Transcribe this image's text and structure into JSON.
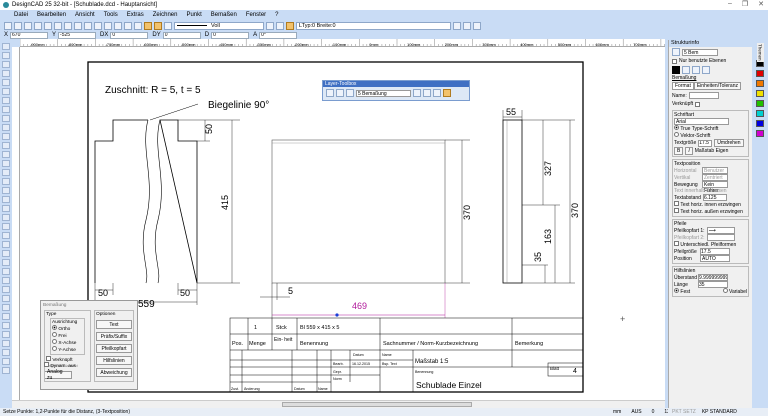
{
  "app": {
    "title": "DesignCAD 25 32-bit - [Schublade.dcd - Hauptansicht]",
    "window_controls": [
      "–",
      "❐",
      "✕"
    ]
  },
  "menu": [
    "Datei",
    "Bearbeiten",
    "Ansicht",
    "Tools",
    "Extras",
    "Zeichnen",
    "Punkt",
    "Bemaßen",
    "Fenster",
    "?"
  ],
  "toolbar": {
    "line_style": "Voll",
    "line_type": "LTyp:0  Breite:0"
  },
  "coords": {
    "x_label": "X",
    "x": "670",
    "y_label": "Y",
    "y": "-525",
    "dx_label": "DX",
    "dx": "0",
    "dy_label": "DY",
    "dy": "0",
    "d_label": "D",
    "d": "0",
    "a_label": "A",
    "a": "0°"
  },
  "ruler": {
    "labels": [
      "-900mm",
      "-800mm",
      "-700mm",
      "-600mm",
      "-500mm",
      "-400mm",
      "-300mm",
      "-200mm",
      "-100mm",
      "0mm",
      "100mm",
      "200mm",
      "300mm",
      "400mm",
      "500mm",
      "600mm",
      "700mm"
    ]
  },
  "drawing": {
    "note": "Zuschnitt: R = 5,  t = 5",
    "bend_label": "Biegelinie 90°",
    "dims": {
      "d50a": "50",
      "d415": "415",
      "d50b": "50",
      "d50c": "50",
      "d559": "559",
      "d370a": "370",
      "d5": "5",
      "d469": "469",
      "d55": "55",
      "d327": "327",
      "d163": "163",
      "d35": "35",
      "d370b": "370"
    },
    "dim_color": "#b0199a",
    "point_color": "#1a3fd6"
  },
  "title_block": {
    "pos_value": "1",
    "unit_value": "Stck",
    "desc_value": "Bl  559 x 415 x 5",
    "headers": [
      "Pos.",
      "Menge",
      "Ein-\nheit",
      "Benennung",
      "Sachnummer / Norm-Kurzbezeichnung",
      "Bemerkung"
    ],
    "datum": "Datum",
    "name": "Name",
    "bearb": "Bearb.",
    "date": "16.12.2015",
    "author": "Bsp. Text",
    "gepr": "Gepr.",
    "norm": "Norm",
    "zust": "Zust.",
    "aenderung": "Änderung",
    "datum2": "Datum",
    "name2": "Name",
    "scale_label": "Maßstab",
    "scale": "1:5",
    "benennung_label": "Benennung",
    "drawing_name": "Schublade Einzel",
    "blatt_label": "Blatt",
    "blatt": "4"
  },
  "layer_toolbox": {
    "title": "Layer-Toolbox",
    "layer": "5  Bemaßung"
  },
  "dimension_dialog": {
    "title": "Bemaßung",
    "type_group": "Type",
    "align_group": "Ausrichtung",
    "align_options": [
      "Ortho",
      "Frei",
      "X-Achse",
      "Y-Achse"
    ],
    "align_selected": "Ortho",
    "linked": "Verknüpft",
    "segment": "Segment",
    "element": "Element",
    "dynamic": "Dynam. aus",
    "analog_button": "Analog zu",
    "options_group": "Optionen",
    "buttons": [
      "Text",
      "Präfix/Suffix",
      "Pfeilkopfart",
      "Hilfslinien",
      "Abweichung"
    ]
  },
  "struct_panel": {
    "title": "Strukturinfo",
    "layer": "5  Bem",
    "only_used": "Nur benutzte Ebenen",
    "section": "Bemaßung",
    "tabs": [
      "Format",
      "Einheiten/Toleranz"
    ],
    "name_label": "Name:",
    "name_value": "",
    "linked": "Verknüpft",
    "font_group": "Schriftart",
    "font": "Arial",
    "truetype": "True Type-Schrift",
    "vector": "Vektor-Schrift",
    "textsize_label": "Textgröße",
    "textsize": "17.5",
    "swap_button": "Umdrehen",
    "bold": "B",
    "italic": "I",
    "scale_own": "Maßstab Eigen",
    "textpos_group": "Textposition",
    "horizontal_label": "Horizontal",
    "horizontal": "Benutzer",
    "vertical_label": "Vertikal",
    "vertical": "Zentriert",
    "movement_label": "Bewegung",
    "movement": "Kein Führer",
    "inside": "Text innerhalb belassen",
    "textdist_label": "Textabstand",
    "textdist": "6.125",
    "force_inside": "Text horiz. innen erzwingen",
    "force_outside": "Text horiz. außen erzwingen",
    "arrows_group": "Pfeile",
    "arrow1_label": "Pfeilkopfart 1:",
    "arrow2_label": "Pfeilkopfart 2:",
    "diff_arrows": "Unterschiedl. Pfeilformen",
    "arrowsize_label": "Pfeilgröße",
    "arrowsize": "17.5",
    "position_label": "Position",
    "position": "AUTO",
    "ext_group": "Hilfslinien",
    "overhang_label": "Überstand",
    "overhang": "9.99999999992",
    "length_label": "Länge",
    "length": "35",
    "fixed": "Fest",
    "variable": "Variabel",
    "side_tab": "Themen"
  },
  "palette": [
    "#000000",
    "#e00000",
    "#f07800",
    "#f0e000",
    "#20c000",
    "#00d0d0",
    "#0000e0",
    "#d000d0"
  ],
  "status": {
    "message": "Setze Punkte: 1,2-Punkte für die Distanz, (3-Textposition)",
    "unit": "mm",
    "snap": "AUS",
    "value": "0",
    "zoom": "12%",
    "mode": "PKT SETZ",
    "kp": "KP STANDARD"
  }
}
